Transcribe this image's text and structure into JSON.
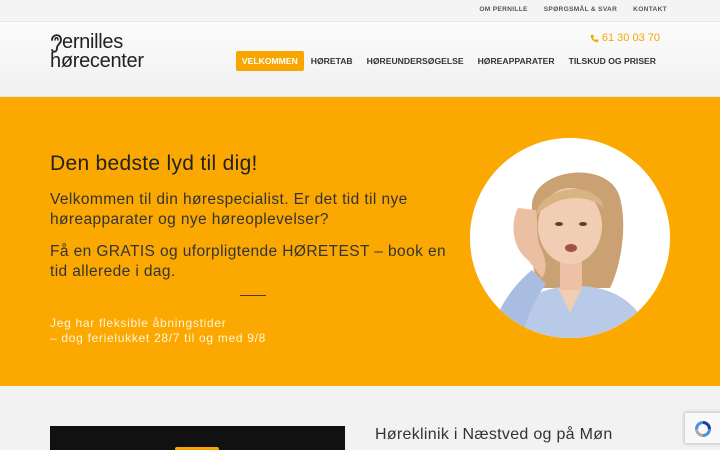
{
  "colors": {
    "accent": "#f7a600",
    "hero_bg": "#fba900"
  },
  "topbar": {
    "links": [
      "OM PERNILLE",
      "SPØRGSMÅL & SVAR",
      "KONTAKT"
    ]
  },
  "header": {
    "logo": {
      "line1": "ernilles",
      "line2": "hørecenter"
    },
    "phone": {
      "icon": "phone-icon",
      "number": "61 30 03 70"
    },
    "nav": [
      "VELKOMMEN",
      "HØRETAB",
      "HØREUNDERSØGELSE",
      "HØREAPPARATER",
      "TILSKUD OG PRISER"
    ],
    "active_nav": "VELKOMMEN"
  },
  "hero": {
    "title": "Den bedste lyd til dig!",
    "intro": "Velkommen til din hørespecialist. Er det tid til nye høreapparater og nye høreoplevelser?",
    "offer": "Få en GRATIS og uforpligtende HØRETEST – book en tid allerede i dag.",
    "hours_line1": "Jeg har fleksible åbningstider",
    "hours_line2": "– dog ferielukket 28/7 til og med 9/8"
  },
  "lower": {
    "heading": "Høreklinik i Næstved og på Møn"
  },
  "recaptcha": {
    "icon": "recaptcha-icon"
  }
}
